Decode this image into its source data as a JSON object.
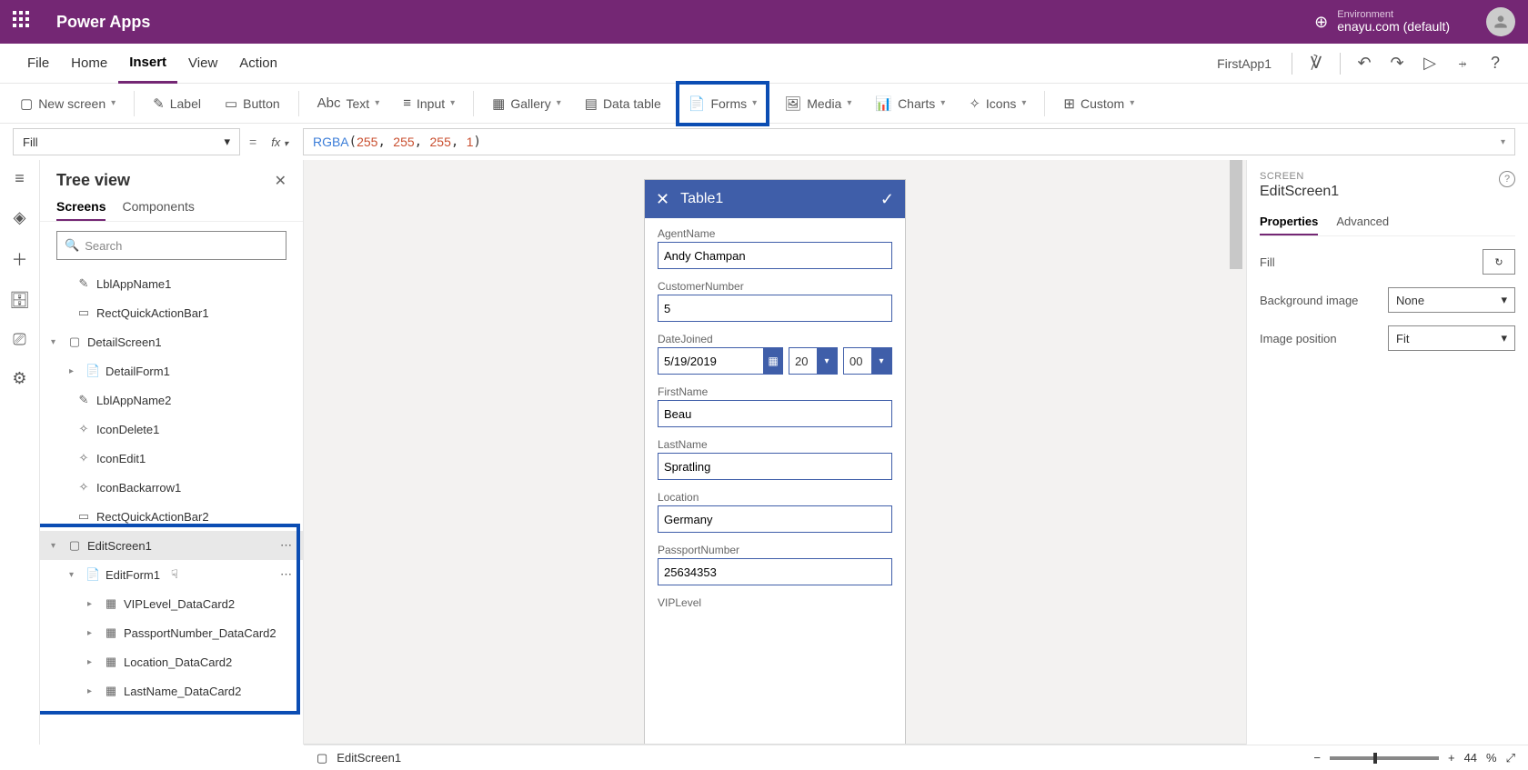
{
  "header": {
    "app": "Power Apps",
    "env_label": "Environment",
    "env_value": "enayu.com (default)"
  },
  "menu": {
    "items": [
      "File",
      "Home",
      "Insert",
      "View",
      "Action"
    ],
    "active": "Insert",
    "appName": "FirstApp1"
  },
  "ribbon": {
    "newScreen": "New screen",
    "label": "Label",
    "button": "Button",
    "text": "Text",
    "input": "Input",
    "gallery": "Gallery",
    "dataTable": "Data table",
    "forms": "Forms",
    "media": "Media",
    "charts": "Charts",
    "icons": "Icons",
    "custom": "Custom"
  },
  "formula": {
    "property": "Fill",
    "fn": "RGBA",
    "args": [
      "255",
      "255",
      "255",
      "1"
    ]
  },
  "tree": {
    "title": "Tree view",
    "tabs": {
      "screens": "Screens",
      "components": "Components"
    },
    "search": "Search",
    "nodes": {
      "lblAppName1": "LblAppName1",
      "rectQuick1": "RectQuickActionBar1",
      "detailScreen1": "DetailScreen1",
      "detailForm1": "DetailForm1",
      "lblAppName2": "LblAppName2",
      "iconDelete1": "IconDelete1",
      "iconEdit1": "IconEdit1",
      "iconBack1": "IconBackarrow1",
      "rectQuick2": "RectQuickActionBar2",
      "editScreen1": "EditScreen1",
      "editForm1": "EditForm1",
      "vipLevel": "VIPLevel_DataCard2",
      "passport": "PassportNumber_DataCard2",
      "location": "Location_DataCard2",
      "lastName": "LastName_DataCard2"
    }
  },
  "form": {
    "title": "Table1",
    "fields": {
      "agentName": {
        "label": "AgentName",
        "value": "Andy Champan"
      },
      "customerNumber": {
        "label": "CustomerNumber",
        "value": "5"
      },
      "dateJoined": {
        "label": "DateJoined",
        "date": "5/19/2019",
        "hour": "20",
        "min": "00"
      },
      "firstName": {
        "label": "FirstName",
        "value": "Beau"
      },
      "lastName": {
        "label": "LastName",
        "value": "Spratling"
      },
      "location": {
        "label": "Location",
        "value": "Germany"
      },
      "passportNumber": {
        "label": "PassportNumber",
        "value": "25634353"
      },
      "vipLevel": {
        "label": "VIPLevel"
      }
    }
  },
  "props": {
    "section": "SCREEN",
    "name": "EditScreen1",
    "tabs": {
      "properties": "Properties",
      "advanced": "Advanced"
    },
    "fill": "Fill",
    "bgImage": "Background image",
    "bgImageVal": "None",
    "imgPos": "Image position",
    "imgPosVal": "Fit"
  },
  "status": {
    "screen": "EditScreen1",
    "zoom": "44",
    "zoomUnit": "%"
  }
}
